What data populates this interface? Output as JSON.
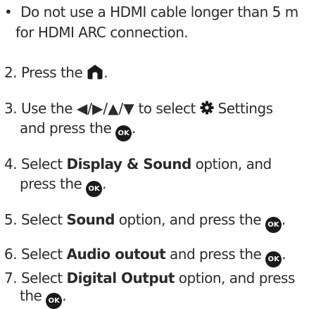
{
  "bullet": {
    "marker": "•",
    "line1": "Do not use a HDMI cable longer than 5 m",
    "line2": "for HDMI ARC connection."
  },
  "steps": [
    {
      "num": "2.",
      "pre": "Press the ",
      "post": "."
    },
    {
      "num": "3.",
      "pre": "Use the ",
      "arrows": "◀/▶/▲/▼",
      "mid": " to select ",
      "settings": " Settings",
      "line2_pre": "and press the ",
      "post": "."
    },
    {
      "num": "4.",
      "pre": "Select ",
      "bold": "Display & Sound",
      "mid": " option, and",
      "line2_pre": "press the ",
      "post": "."
    },
    {
      "num": "5.",
      "pre": "Select ",
      "bold": "Sound",
      "mid": " option, and press the ",
      "post": "."
    },
    {
      "num": "6.",
      "pre": "Select ",
      "bold": "Audio outout",
      "mid": " and press the ",
      "post": "."
    },
    {
      "num": "7.",
      "pre": "Select ",
      "bold": "Digital Output",
      "mid": " option, and press",
      "line2_pre": "the ",
      "post": "."
    }
  ],
  "ok_label": "OK",
  "icons": {
    "home": "home-icon",
    "settings": "gear-icon",
    "ok": "ok-button-icon"
  }
}
